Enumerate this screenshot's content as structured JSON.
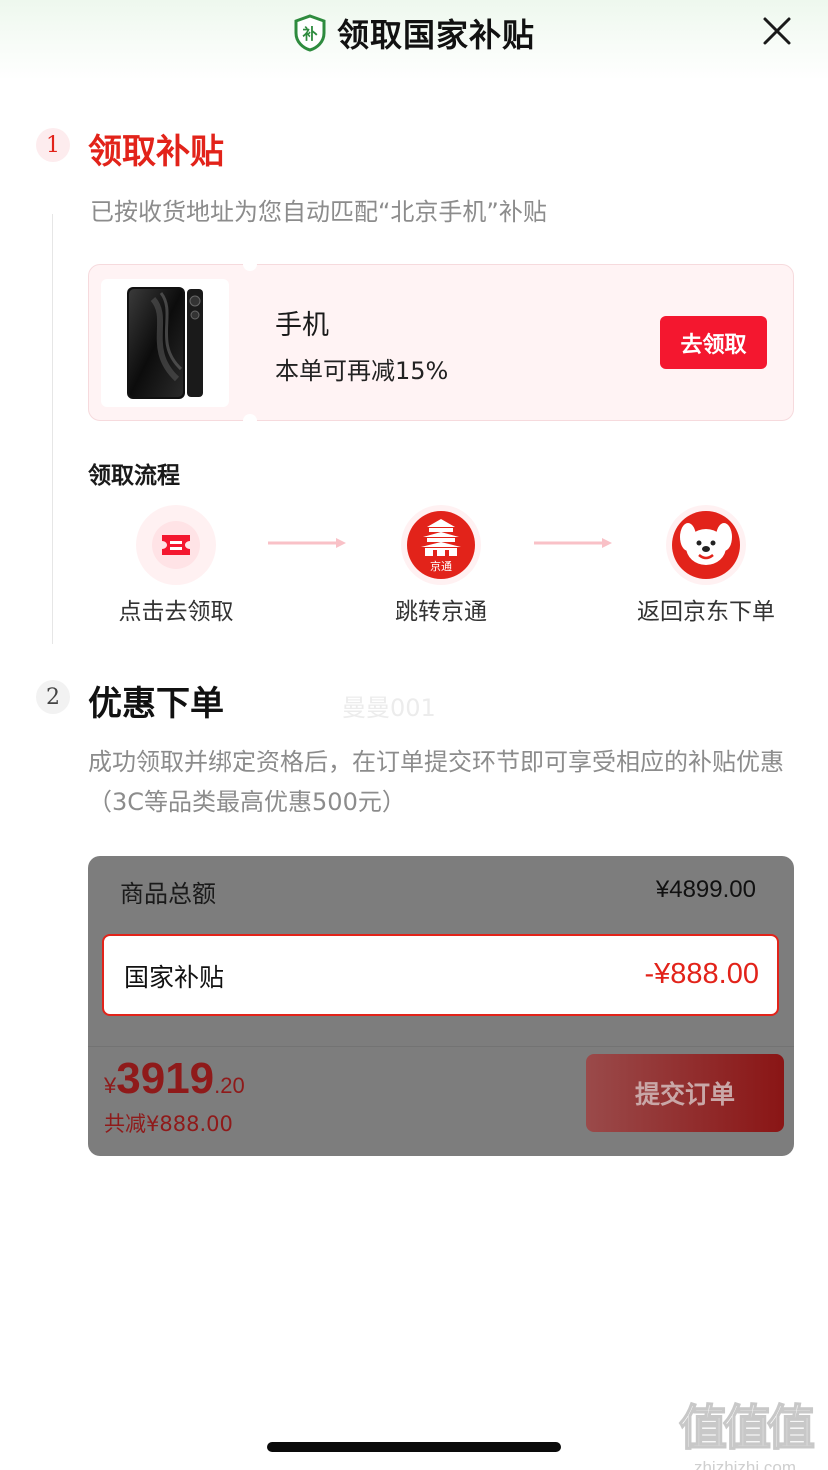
{
  "header": {
    "title": "领取国家补贴",
    "badge_glyph": "补",
    "close_icon": "close-icon"
  },
  "step1": {
    "number": "1",
    "title": "领取补贴",
    "description": "已按收货地址为您自动匹配“北京手机”补贴",
    "product": {
      "name": "手机",
      "benefit": "本单可再减15%",
      "button_label": "去领取"
    },
    "flow": {
      "title": "领取流程",
      "steps": [
        {
          "label": "点击去领取",
          "icon": "ticket-icon"
        },
        {
          "label": "跳转京通",
          "icon": "jingtong-app-icon",
          "icon_caption": "京通"
        },
        {
          "label": "返回京东下单",
          "icon": "jd-mascot-icon"
        }
      ]
    }
  },
  "step2": {
    "number": "2",
    "title": "优惠下单",
    "description": "成功领取并绑定资格后，在订单提交环节即可享受相应的补贴优惠（3C等品类最高优惠500元）",
    "watermark": "曼曼001",
    "order": {
      "total_label": "商品总额",
      "total_value": "¥4899.00",
      "subsidy_label": "国家补贴",
      "subsidy_value": "-¥888.00",
      "price_symbol": "¥",
      "price_int": "3919",
      "price_dec": ".20",
      "saved_text": "共减¥888.00",
      "submit_label": "提交订单"
    }
  },
  "site_watermark": {
    "big": "值值值",
    "small": "zhizhizhi.com"
  },
  "colors": {
    "accent_red": "#e2231a",
    "button_red": "#f4172f",
    "header_green": "#2e8b3e"
  }
}
